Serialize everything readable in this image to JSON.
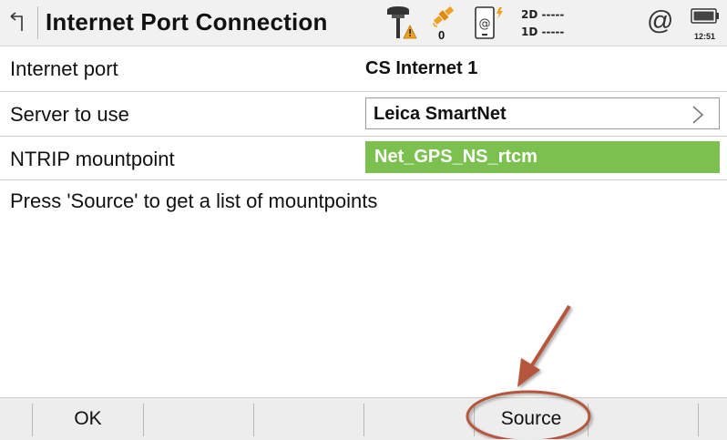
{
  "header": {
    "title": "Internet Port Connection",
    "satellite_count": "0",
    "precision_2d": "2D -----",
    "precision_1d": "1D -----",
    "at_symbol": "@",
    "time": "12:51",
    "icons": [
      "back-arrow-icon",
      "gnss-antenna-warning-icon",
      "satellite-icon",
      "device-connection-icon",
      "internet-at-icon",
      "battery-icon"
    ]
  },
  "form": {
    "rows": [
      {
        "label": "Internet port",
        "value": "CS Internet 1"
      },
      {
        "label": "Server to use",
        "value": "Leica SmartNet"
      },
      {
        "label": "NTRIP mountpoint",
        "value": "Net_GPS_NS_rtcm"
      }
    ],
    "hint": "Press 'Source' to get a list of mountpoints"
  },
  "footer": {
    "buttons": [
      "OK",
      "",
      "",
      "",
      "Source",
      ""
    ]
  },
  "colors": {
    "selected_field": "#7cc04f",
    "annotation": "#b5563d",
    "warning": "#f0a020"
  }
}
